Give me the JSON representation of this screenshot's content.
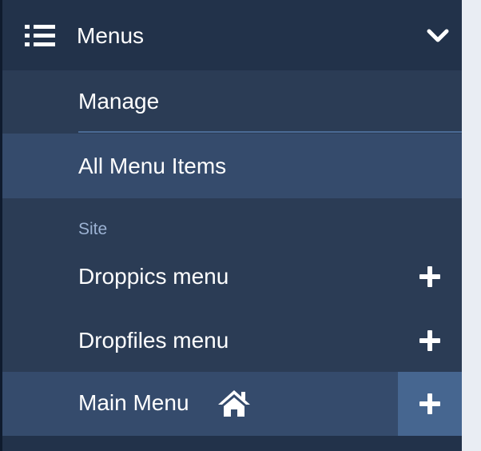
{
  "menus": {
    "title": "Menus",
    "items": {
      "manage": "Manage",
      "all_items": "All Menu Items"
    },
    "section_label": "Site",
    "site_menus": [
      {
        "label": "Droppics menu"
      },
      {
        "label": "Dropfiles menu"
      },
      {
        "label": "Main Menu",
        "is_home": true
      }
    ]
  },
  "icons": {
    "header": "list-icon",
    "collapse": "chevron-down-icon",
    "add": "plus-icon",
    "home": "home-icon"
  },
  "colors": {
    "sidebar_bg": "#2b3c55",
    "header_bg": "#22324a",
    "active_row_bg": "#354b6c",
    "add_button_bg": "#466690",
    "section_label": "#9cb2d3",
    "text": "#ffffff"
  }
}
